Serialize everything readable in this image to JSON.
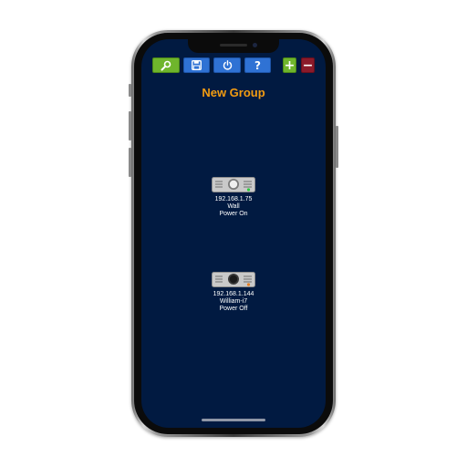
{
  "toolbar": {
    "settings_icon": "wrench-icon",
    "save_icon": "floppy-disk-icon",
    "power_icon": "power-icon",
    "help_label": "?",
    "add_label": "+",
    "remove_label": "−",
    "colors": {
      "green": "#6fb52c",
      "blue": "#2f72d4",
      "red": "#8b1a2a"
    }
  },
  "group": {
    "title": "New Group",
    "title_color": "#f39c12"
  },
  "devices": [
    {
      "ip": "192.168.1.75",
      "name": "Wall",
      "status": "Power On",
      "indicator_color": "#2ecc40",
      "lens": "light"
    },
    {
      "ip": "192.168.1.144",
      "name": "William-i7",
      "status": "Power Off",
      "indicator_color": "#e67e22",
      "lens": "dark"
    }
  ],
  "screen": {
    "background": "#011a41"
  }
}
